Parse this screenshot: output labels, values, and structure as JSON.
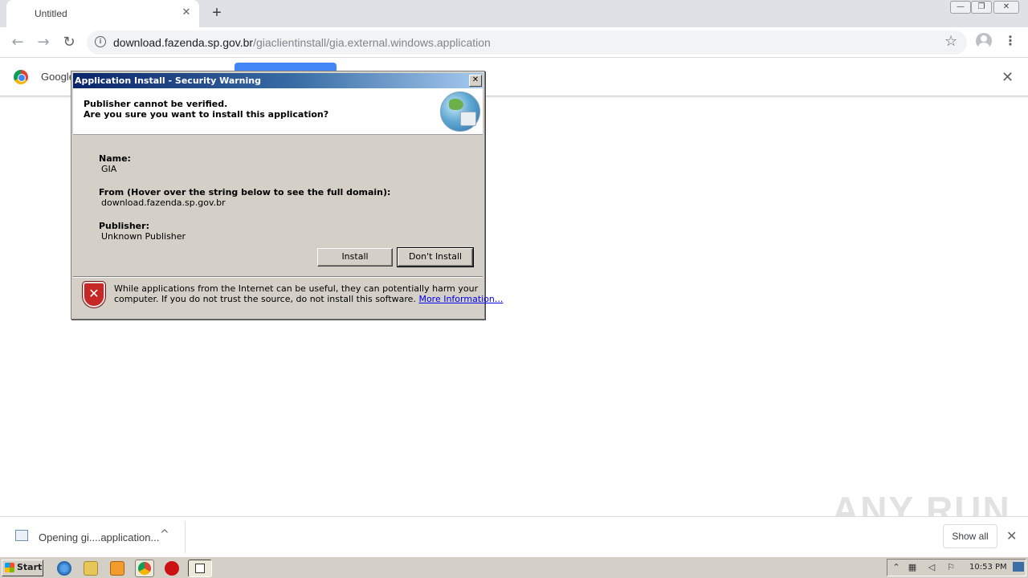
{
  "browser": {
    "tab_title": "Untitled",
    "tab_close_glyph": "✕",
    "new_tab_glyph": "+",
    "url_host": "download.fazenda.sp.gov.br",
    "url_path": "/giaclientinstall/gia.external.windows.application",
    "info_icon_glyph": "i",
    "star_glyph": "☆",
    "menu_glyph": "⋮",
    "back_glyph": "←",
    "forward_glyph": "→",
    "reload_glyph": "↻",
    "window_minimize_glyph": "—",
    "window_restore_glyph": "❐",
    "window_close_glyph": "✕"
  },
  "infobar": {
    "text": "Google",
    "close_glyph": "✕",
    "button_color": "#4285f4"
  },
  "dialog": {
    "title": "Application Install - Security Warning",
    "close_glyph": "✕",
    "header_line1": "Publisher cannot be verified.",
    "header_line2": "Are you sure you want to install this application?",
    "name_label": "Name:",
    "name_value": "GIA",
    "from_label": "From (Hover over the string below to see the full domain):",
    "from_value": "download.fazenda.sp.gov.br",
    "publisher_label": "Publisher:",
    "publisher_value": "Unknown Publisher",
    "install_label": "Install",
    "dont_install_label": "Don't Install",
    "warning_line1": "While applications from the Internet can be useful, they can potentially harm your",
    "warning_line2": "computer. If you do not trust the source, do not install this software.",
    "more_info_link": "More Information...",
    "shield_glyph": "✕"
  },
  "download_shelf": {
    "item_name": "Opening gi....application...",
    "chevron_glyph": "^",
    "show_all_label": "Show all",
    "close_glyph": "✕"
  },
  "watermark": "ANY RUN",
  "taskbar": {
    "start_label": "Start",
    "clock": "10:53 PM"
  }
}
